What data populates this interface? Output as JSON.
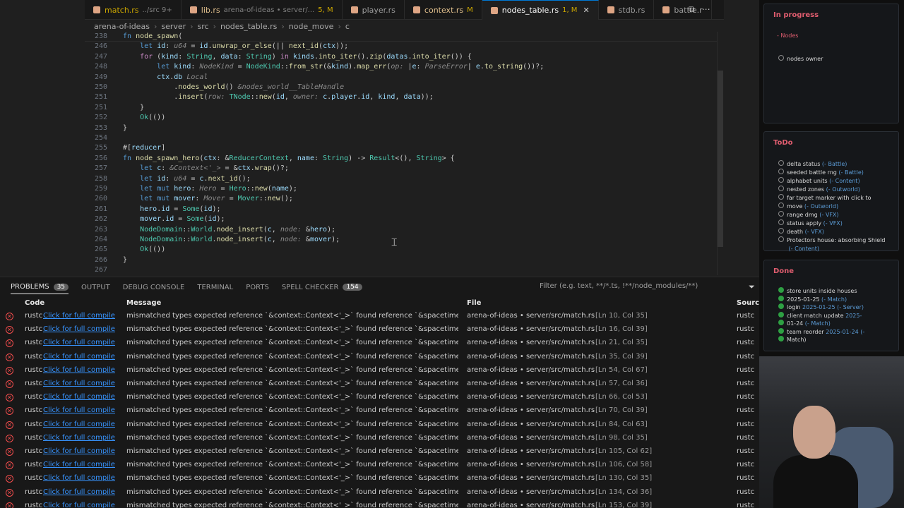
{
  "tabs": [
    {
      "name": "match.rs",
      "desc": "../src 9+",
      "style": "warn"
    },
    {
      "name": "lib.rs",
      "desc": "arena-of-ideas • server/...",
      "mark": "5, M",
      "style": "mod"
    },
    {
      "name": "player.rs",
      "desc": "",
      "style": "plain"
    },
    {
      "name": "context.rs",
      "mark": "M",
      "style": "mod"
    },
    {
      "name": "nodes_table.rs",
      "mark": "1, M",
      "active": true
    },
    {
      "name": "stdb.rs",
      "style": "plain"
    },
    {
      "name": "battle.r",
      "style": "plain"
    }
  ],
  "breadcrumb": [
    "arena-of-ideas",
    "server",
    "src",
    "nodes_table.rs",
    "node_move",
    "c"
  ],
  "code_lines": [
    {
      "n": "238",
      "html": "<span class='k'>fn</span> <span class='fn'>node_spawn</span>("
    },
    {
      "n": "246",
      "html": "    <span class='k'>let</span> <span class='v'>id</span>: <span class='hint'>u64</span> = <span class='v'>id</span>.<span class='fn'>unwrap_or_else</span>(|| <span class='fn'>next_id</span>(<span class='v'>ctx</span>));"
    },
    {
      "n": "247",
      "html": "    <span class='kw'>for</span> (<span class='v'>kind</span>: <span class='ty'>String</span>, <span class='v'>data</span>: <span class='ty'>String</span>) <span class='kw'>in</span> <span class='v'>kinds</span>.<span class='fn'>into_iter</span>().<span class='fn'>zip</span>(<span class='v'>datas</span>.<span class='fn'>into_iter</span>()) {"
    },
    {
      "n": "248",
      "html": "        <span class='k'>let</span> <span class='v'>kind</span>: <span class='hint'>NodeKind</span> = <span class='ty'>NodeKind</span>::<span class='fn'>from_str</span>(&amp;<span class='v'>kind</span>).<span class='fn'>map_err</span>(<span class='hint'>op:</span> |<span class='v'>e</span>: <span class='hint'>ParseError</span>| <span class='v'>e</span>.<span class='fn'>to_string</span>())?;"
    },
    {
      "n": "249",
      "html": "        <span class='v'>ctx</span>.<span class='v'>db</span> <span class='hint'>Local</span>"
    },
    {
      "n": "250",
      "html": "            .<span class='fn'>nodes_world</span>() <span class='hint'>&amp;nodes_world__TableHandle</span>"
    },
    {
      "n": "251",
      "html": "            .<span class='fn'>insert</span>(<span class='hint'>row:</span> <span class='ty'>TNode</span>::<span class='fn'>new</span>(<span class='v'>id</span>, <span class='hint'>owner:</span> <span class='v'>c</span>.<span class='v'>player</span>.<span class='v'>id</span>, <span class='v'>kind</span>, <span class='v'>data</span>));"
    },
    {
      "n": "251",
      "html": "    }"
    },
    {
      "n": "252",
      "html": "    <span class='ty'>Ok</span>(())"
    },
    {
      "n": "253",
      "html": "}"
    },
    {
      "n": "254",
      "html": ""
    },
    {
      "n": "255",
      "html": "#[<span class='v'>reducer</span>]"
    },
    {
      "n": "256",
      "html": "<span class='k'>fn</span> <span class='fn'>node_spawn_hero</span>(<span class='v'>ctx</span>: &amp;<span class='ty'>ReducerContext</span>, <span class='v'>name</span>: <span class='ty'>String</span>) -&gt; <span class='ty'>Result</span>&lt;(), <span class='ty'>String</span>&gt; {"
    },
    {
      "n": "257",
      "html": "    <span class='k'>let</span> <span class='v'>c</span>: <span class='hint'>&amp;Context&lt;'_&gt;</span> = &amp;<span class='v'>ctx</span>.<span class='fn'>wrap</span>()?;"
    },
    {
      "n": "258",
      "html": "    <span class='k'>let</span> <span class='v'>id</span>: <span class='hint'>u64</span> = <span class='v'>c</span>.<span class='fn'>next_id</span>();"
    },
    {
      "n": "259",
      "html": "    <span class='k'>let</span> <span class='k'>mut</span> <span class='v'>hero</span>: <span class='hint'>Hero</span> = <span class='ty'>Hero</span>::<span class='fn'>new</span>(<span class='v'>name</span>);"
    },
    {
      "n": "260",
      "html": "    <span class='k'>let</span> <span class='k'>mut</span> <span class='v'>mover</span>: <span class='hint'>Mover</span> = <span class='ty'>Mover</span>::<span class='fn'>new</span>();"
    },
    {
      "n": "261",
      "html": "    <span class='v'>hero</span>.<span class='v'>id</span> = <span class='ty'>Some</span>(<span class='v'>id</span>);"
    },
    {
      "n": "262",
      "html": "    <span class='v'>mover</span>.<span class='v'>id</span> = <span class='ty'>Some</span>(<span class='v'>id</span>);"
    },
    {
      "n": "263",
      "html": "    <span class='ty'>NodeDomain</span>::<span class='ty'>World</span>.<span class='fn'>node_insert</span>(<span class='v'>c</span>, <span class='hint'>node:</span> &amp;<span class='v'>hero</span>);"
    },
    {
      "n": "264",
      "html": "    <span class='ty'>NodeDomain</span>::<span class='ty'>World</span>.<span class='fn'>node_insert</span>(<span class='v'>c</span>, <span class='hint'>node:</span> &amp;<span class='v'>mover</span>);"
    },
    {
      "n": "265",
      "html": "    <span class='ty'>Ok</span>(())"
    },
    {
      "n": "266",
      "html": "}"
    },
    {
      "n": "267",
      "html": ""
    }
  ],
  "panel": {
    "tabs": [
      {
        "label": "PROBLEMS",
        "badge": "35",
        "active": true
      },
      {
        "label": "OUTPUT"
      },
      {
        "label": "DEBUG CONSOLE"
      },
      {
        "label": "TERMINAL"
      },
      {
        "label": "PORTS"
      },
      {
        "label": "SPELL CHECKER",
        "badge": "154"
      }
    ],
    "filter_placeholder": "Filter (e.g. text, **/*.ts, !**/node_modules/**)",
    "columns": {
      "code": "Code",
      "message": "Message",
      "file": "File",
      "source": "Source"
    },
    "rows": [
      {
        "loc": "[Ln 10, Col 35]"
      },
      {
        "loc": "[Ln 16, Col 39]"
      },
      {
        "loc": "[Ln 21, Col 35]"
      },
      {
        "loc": "[Ln 35, Col 39]"
      },
      {
        "loc": "[Ln 54, Col 67]"
      },
      {
        "loc": "[Ln 57, Col 36]"
      },
      {
        "loc": "[Ln 66, Col 53]"
      },
      {
        "loc": "[Ln 70, Col 39]"
      },
      {
        "loc": "[Ln 84, Col 63]"
      },
      {
        "loc": "[Ln 98, Col 35]"
      },
      {
        "loc": "[Ln 105, Col 62]"
      },
      {
        "loc": "[Ln 106, Col 58]"
      },
      {
        "loc": "[Ln 130, Col 35]"
      },
      {
        "loc": "[Ln 134, Col 36]"
      },
      {
        "loc": "[Ln 153, Col 39]"
      }
    ],
    "row_common": {
      "code": "rustc",
      "link": "Click for full compile",
      "message": "mismatched types expected reference `&context::Context<'_>` found reference `&spacetimed...",
      "file": "arena-of-ideas • server/src/match.rs",
      "source": "rustc"
    }
  },
  "kanban": {
    "in_progress": {
      "title": "In progress",
      "sub": "- Nodes",
      "items": [
        "nodes owner"
      ]
    },
    "todo": {
      "title": "ToDo",
      "items": [
        {
          "t": "delta status",
          "tag": "(- Battle)"
        },
        {
          "t": "seeded battle rng",
          "tag": "(- Battle)"
        },
        {
          "t": "alphabet units",
          "tag": "(- Content)"
        },
        {
          "t": "nested zones",
          "tag": "(- Outworld)"
        },
        {
          "t": "far target marker with click to",
          "tag": ""
        },
        {
          "t": "move",
          "tag": "(- Outworld)"
        },
        {
          "t": "range dmg",
          "tag": "(- VFX)"
        },
        {
          "t": "status apply",
          "tag": "(- VFX)"
        },
        {
          "t": "death",
          "tag": "(- VFX)"
        },
        {
          "t": "Protectors house: absorbing Shield",
          "tag": ""
        },
        {
          "t": "",
          "tag": "(- Content)"
        }
      ]
    },
    "done": {
      "title": "Done",
      "items": [
        {
          "t": "store units inside houses",
          "tag": ""
        },
        {
          "t": "2025-01-25",
          "tag": "(- Match)"
        },
        {
          "t": "login",
          "tag": "2025-01-25 (- Server)"
        },
        {
          "t": "client match update",
          "tag": "2025-"
        },
        {
          "t": "01-24",
          "tag": "(- Match)"
        },
        {
          "t": "team reorder",
          "tag": "2025-01-24 (-"
        },
        {
          "t": "Match)",
          "tag": ""
        }
      ]
    }
  }
}
